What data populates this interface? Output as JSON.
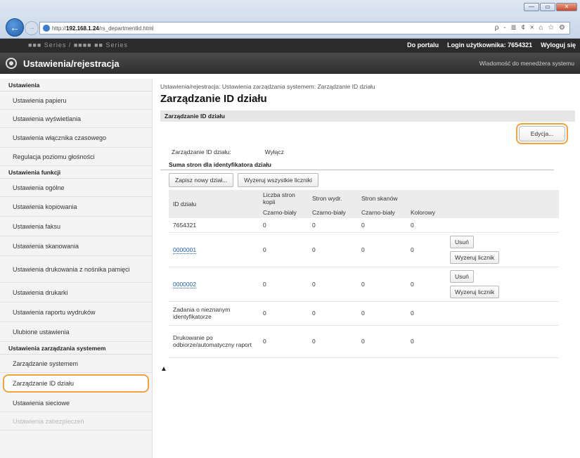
{
  "browser": {
    "url_prefix": "http://",
    "url_host": "192.168.1.24",
    "url_path": "/rs_departmentId.html",
    "addr_icons": "ρ - ≣ ¢ × ⌂ ☆ ⚙",
    "win_min": "—",
    "win_max": "▭",
    "win_close": "✕"
  },
  "topbar": {
    "model_name": "■■■ Series / ■■■■ ■■ Series",
    "portal_link": "Do portalu",
    "login_label": "Login użytkownika: 7654321",
    "logout_link": "Wyloguj się"
  },
  "titlebar": {
    "title": "Ustawienia/rejestracja",
    "admin_msg": "Wiadomość do menedżera systemu"
  },
  "sidebar": {
    "sections": [
      {
        "title": "Ustawienia",
        "items": [
          "Ustawienia papieru",
          "Ustawienia wyświetlania",
          "Ustawienia włącznika czasowego",
          "Regulacja poziomu głośności"
        ]
      },
      {
        "title": "Ustawienia funkcji",
        "items": [
          "Ustawienia ogólne",
          "Ustawienia kopiowania",
          "Ustawienia faksu",
          "Ustawienia skanowania",
          "Ustawienia drukowania z nośnika pamięci",
          "Ustawienia drukarki",
          "Ustawienia raportu wydruków",
          "Ulubione ustawienia"
        ]
      },
      {
        "title": "Ustawienia zarządzania systemem",
        "items": [
          "Zarządzanie systemem",
          "Zarządzanie ID działu",
          "Ustawienia sieciowe",
          "Ustawienia zabezpieczeń"
        ]
      }
    ]
  },
  "main": {
    "breadcrumb": "Ustawienia/rejestracja: Ustawienia zarządzania systemem: Zarządzanie ID działu",
    "page_title": "Zarządzanie ID działu",
    "section_title": "Zarządzanie ID działu",
    "edit_button": "Edycja...",
    "setting_label": "Zarządzanie ID działu:",
    "setting_value": "Wyłącz",
    "counter_heading": "Suma stron dla identyfikatora działu",
    "register_button": "Zapisz nowy dział...",
    "reset_all_button": "Wyzeruj wszystkie liczniki",
    "table": {
      "col_id": "ID działu",
      "group_copy": "Liczba stron kopii",
      "group_print": "Stron wydr.",
      "group_scan": "Stron skanów",
      "sub_bw1": "Czarno-biały",
      "sub_bw2": "Czarno-biały",
      "sub_bw3": "Czarno-biały",
      "sub_color": "Kolorowy",
      "delete_label": "Usuń",
      "reset_label": "Wyzeruj licznik",
      "rows": [
        {
          "id": "7654321",
          "copy": "0",
          "print": "0",
          "scan_bw": "0",
          "scan_color": "0"
        },
        {
          "id": "0000001",
          "copy": "0",
          "print": "0",
          "scan_bw": "0",
          "scan_color": "0"
        },
        {
          "id": "0000002",
          "copy": "0",
          "print": "0",
          "scan_bw": "0",
          "scan_color": "0"
        },
        {
          "id": "Zadania o nieznanym identyfikatorze",
          "copy": "0",
          "print": "0",
          "scan_bw": "0",
          "scan_color": "0"
        },
        {
          "id": "Drukowanie po odbiorze/automatyczny raport",
          "copy": "0",
          "print": "0",
          "scan_bw": "0",
          "scan_color": "0"
        }
      ]
    },
    "top_link": "▲"
  }
}
